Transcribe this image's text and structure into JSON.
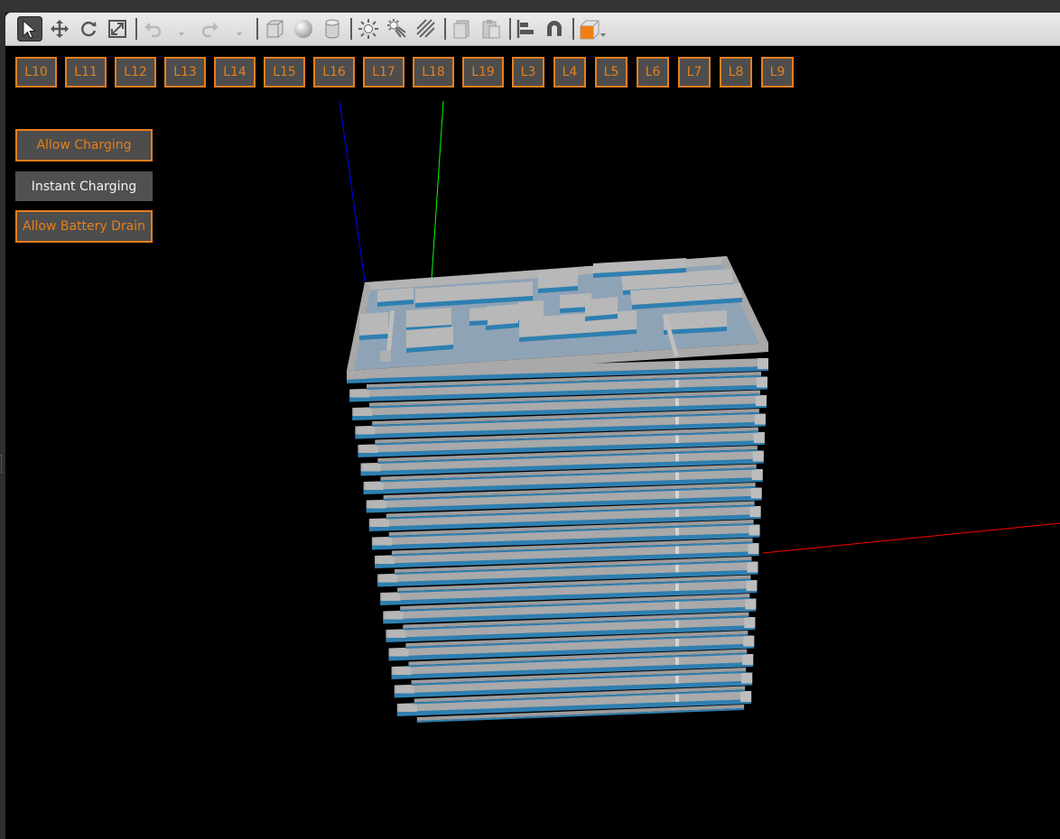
{
  "toolbar": {
    "tools": [
      {
        "name": "select-tool",
        "icon": "arrow-cursor-icon",
        "active": true
      },
      {
        "name": "translate-tool",
        "icon": "move-arrows-icon"
      },
      {
        "name": "rotate-tool",
        "icon": "rotate-icon"
      },
      {
        "name": "scale-tool",
        "icon": "scale-icon"
      },
      {
        "name": "undo",
        "icon": "undo-icon"
      },
      {
        "name": "redo",
        "icon": "redo-icon"
      },
      {
        "name": "box-shape",
        "icon": "box-icon"
      },
      {
        "name": "sphere-shape",
        "icon": "sphere-icon"
      },
      {
        "name": "cylinder-shape",
        "icon": "cylinder-icon"
      },
      {
        "name": "point-light",
        "icon": "sun-icon"
      },
      {
        "name": "spot-light",
        "icon": "spot-light-icon"
      },
      {
        "name": "directional-light",
        "icon": "directional-light-icon"
      },
      {
        "name": "copy",
        "icon": "copy-icon"
      },
      {
        "name": "paste",
        "icon": "paste-icon"
      },
      {
        "name": "align",
        "icon": "align-icon"
      },
      {
        "name": "snap",
        "icon": "magnet-icon"
      },
      {
        "name": "view-angle",
        "icon": "view-cube-icon"
      }
    ]
  },
  "levels": [
    "L10",
    "L11",
    "L12",
    "L13",
    "L14",
    "L15",
    "L16",
    "L17",
    "L18",
    "L19",
    "L3",
    "L4",
    "L5",
    "L6",
    "L7",
    "L8",
    "L9"
  ],
  "side_buttons": {
    "allow_charging": "Allow Charging",
    "instant_charging": "Instant Charging",
    "allow_battery_drain": "Allow Battery Drain"
  },
  "colors": {
    "accent_orange": "#e87e1d",
    "floor_gray": "#a9a9a9",
    "floor_blue": "#2f7fb0",
    "top_floor": "#8fa3b6",
    "axis_x": "#ff0000",
    "axis_y": "#00ff00",
    "axis_z": "#0000ff"
  }
}
